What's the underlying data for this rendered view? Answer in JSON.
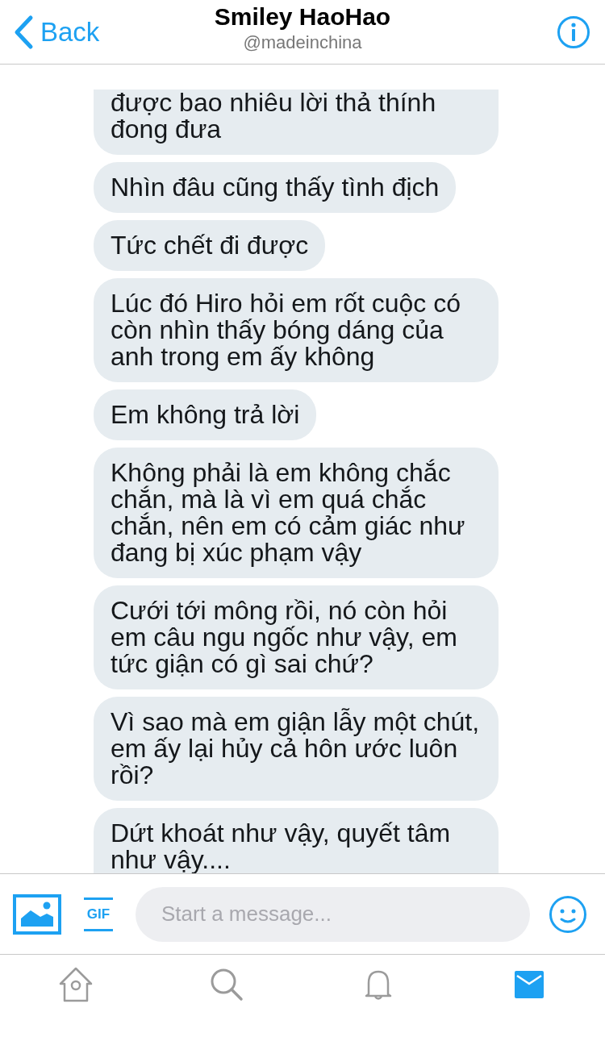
{
  "header": {
    "back_label": "Back",
    "title": "Smiley HaoHao",
    "handle": "@madeinchina"
  },
  "messages": [
    {
      "text": "được bao nhiêu lời thả thính đong đưa"
    },
    {
      "text": "Nhìn đâu cũng thấy tình địch"
    },
    {
      "text": "Tức chết đi được"
    },
    {
      "text": "Lúc đó Hiro hỏi em rốt cuộc có còn nhìn thấy bóng dáng của anh trong em ấy không"
    },
    {
      "text": "Em không trả lời"
    },
    {
      "text": "Không phải là em không chắc chắn, mà là vì em quá chắc chắn, nên em có cảm giác như đang bị xúc phạm vậy"
    },
    {
      "text": "Cưới tới mông rồi, nó còn hỏi em câu ngu ngốc như vậy, em tức giận có gì sai chứ?"
    },
    {
      "text": "Vì sao mà em giận lẫy một chút, em ấy lại hủy cả hôn ước luôn rồi?"
    },
    {
      "text": "Dứt khoát như vậy, quyết tâm như vậy...."
    }
  ],
  "composer": {
    "gif_label": "GIF",
    "placeholder": "Start a message..."
  },
  "tab_bar": [
    {
      "kind": "home",
      "selected": false
    },
    {
      "kind": "search",
      "selected": false
    },
    {
      "kind": "notifications",
      "selected": false
    },
    {
      "kind": "messages",
      "selected": true
    }
  ]
}
